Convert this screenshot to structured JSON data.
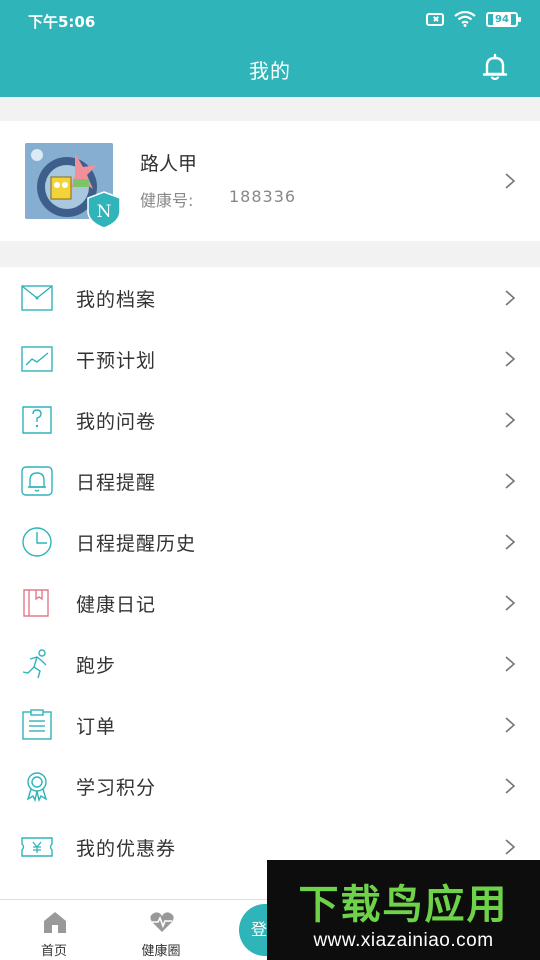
{
  "status_bar": {
    "time": "下午5:06",
    "battery": "94",
    "icons": [
      "sim-off-icon",
      "wifi-icon",
      "battery-icon"
    ]
  },
  "header": {
    "title": "我的",
    "action_icon": "bell-icon"
  },
  "profile": {
    "name": "路人甲",
    "health_label": "健康号:",
    "health_number": "188336",
    "badge_letter": "N"
  },
  "menu": {
    "items": [
      {
        "label": "我的档案",
        "icon": "envelope-icon"
      },
      {
        "label": "干预计划",
        "icon": "trend-chart-icon"
      },
      {
        "label": "我的问卷",
        "icon": "question-doc-icon"
      },
      {
        "label": "日程提醒",
        "icon": "bell-outline-icon"
      },
      {
        "label": "日程提醒历史",
        "icon": "clock-icon"
      },
      {
        "label": "健康日记",
        "icon": "diary-book-icon"
      },
      {
        "label": "跑步",
        "icon": "runner-icon"
      },
      {
        "label": "订单",
        "icon": "clipboard-icon"
      },
      {
        "label": "学习积分",
        "icon": "medal-icon"
      },
      {
        "label": "我的优惠券",
        "icon": "coupon-icon"
      }
    ]
  },
  "tabbar": {
    "tabs": [
      {
        "label": "首页",
        "icon": "home-icon"
      },
      {
        "label": "健康圈",
        "icon": "heart-pulse-icon"
      }
    ],
    "center_button": "登"
  },
  "watermark": {
    "title": "下载鸟应用",
    "url": "www.xiazainiao.com"
  },
  "colors": {
    "brand": "#2fb4b9",
    "diary_icon": "#e07b8a",
    "watermark_green": "#6fd34a"
  }
}
